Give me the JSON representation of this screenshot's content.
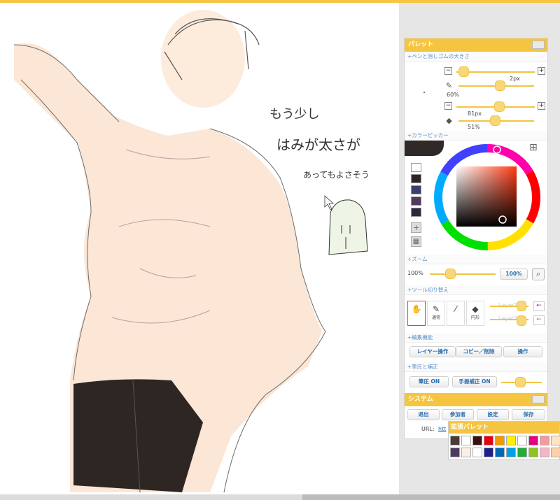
{
  "palette": {
    "title": "パレット",
    "pen_size": {
      "title": "ペンと消しゴムの大きさ",
      "pen_size_value": "2px",
      "pen_opacity_value": "60%",
      "eraser_size_value": "81px",
      "eraser_opacity_value": "51%",
      "minus": "−",
      "plus": "+"
    },
    "color_picker": {
      "title": "カラーピッカー"
    },
    "zoom": {
      "title": "ズーム",
      "label": "100%",
      "button": "100%"
    },
    "tool_switch": {
      "title": "ツール切り替え",
      "tool_normal": "通常",
      "tool_blur": "円形",
      "layer1": "Layer1",
      "layer2": "Layer2"
    },
    "edit": {
      "title": "編集機能",
      "layer_ops": "レイヤー操作",
      "copy_delete": "コピー／削除",
      "operation": "操作"
    },
    "pressure": {
      "title": "筆圧と補正",
      "pressure_on": "筆圧 ON",
      "correction_on": "手振補正 ON"
    }
  },
  "system": {
    "title": "システム",
    "exit": "退出",
    "participants": "参加者",
    "settings": "設定",
    "save": "保存",
    "url_label": "URL:",
    "url_value": "htt"
  },
  "ext_palette": {
    "title": "拡張パレット"
  },
  "canvas": {
    "note_line1": "もう少し",
    "note_line2": "はみが太さが",
    "note_line3": "あってもよさそう"
  },
  "colors": {
    "accent": "#f5c542",
    "history": [
      "#ffffff",
      "#2b2626",
      "#3c3f6d",
      "#4e3a5b",
      "#2c2a3a"
    ],
    "ext_row1": [
      "#4b3a36",
      "#ffffff",
      "#3b1010",
      "#e60012",
      "#f39800",
      "#fff100",
      "#ffffff",
      "#e4007f",
      "#f29c9f",
      "#ffe4c4"
    ],
    "ext_row2": [
      "#4f3b60",
      "#fcefe6",
      "#ffffff",
      "#1d2088",
      "#0068b7",
      "#00a0e9",
      "#22ac38",
      "#8fc31f",
      "#f2b8c6",
      "#ffd0a8"
    ]
  }
}
